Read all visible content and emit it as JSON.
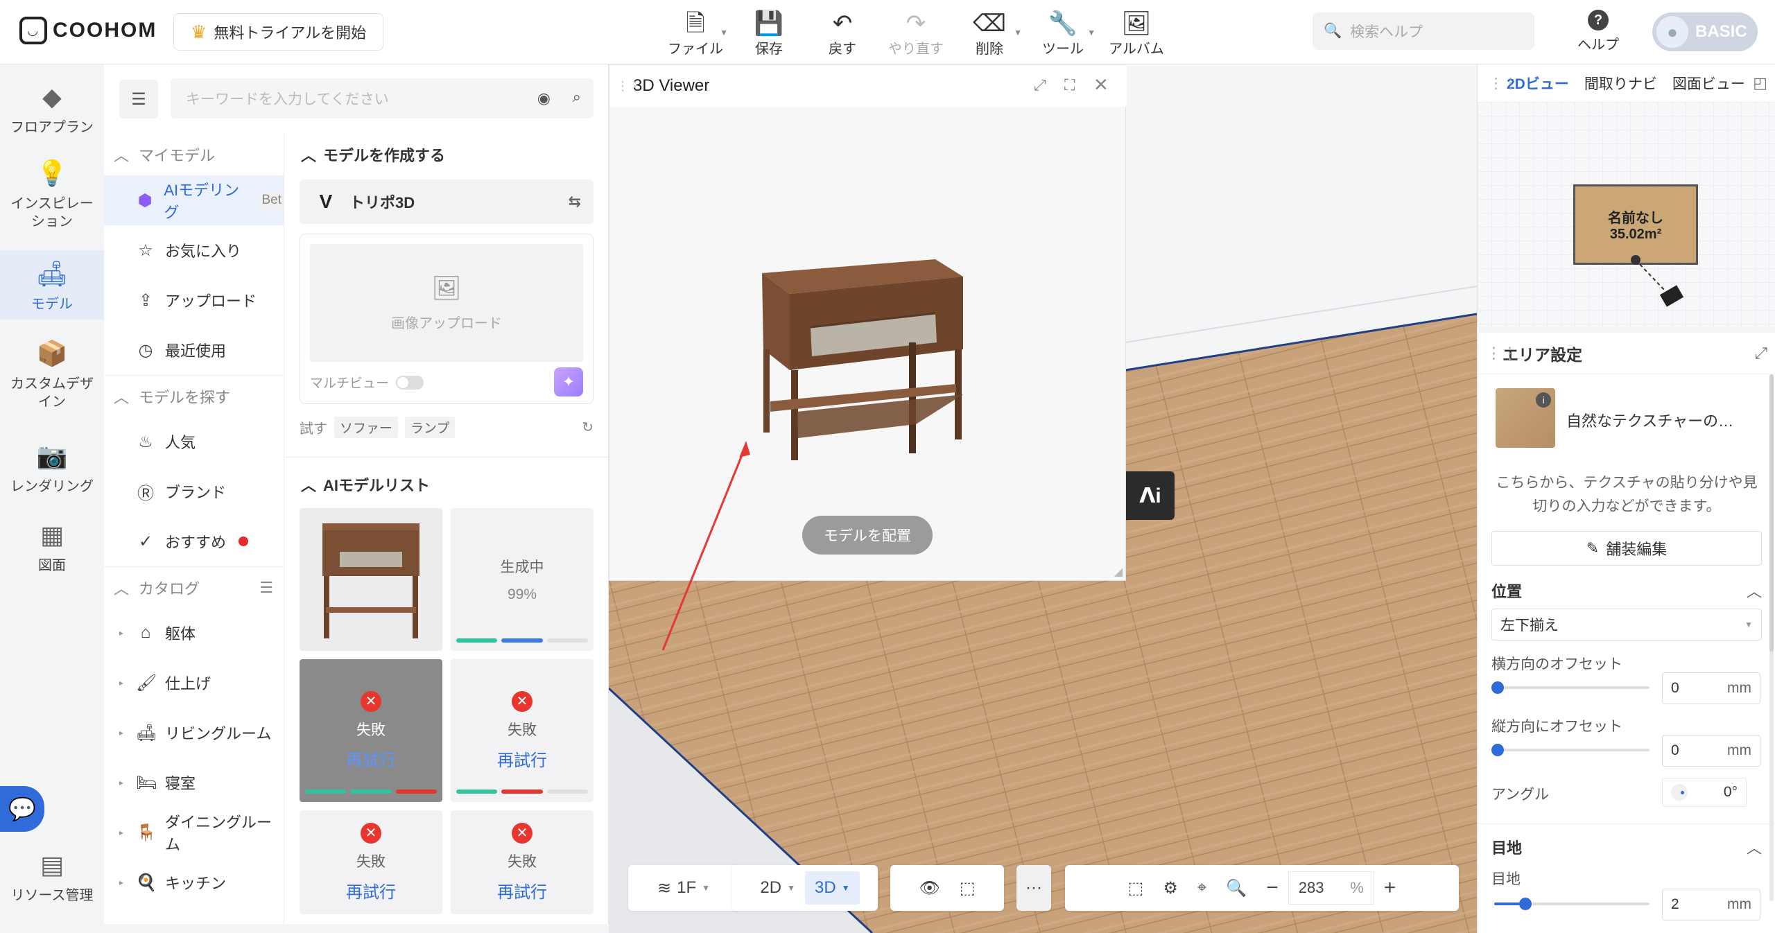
{
  "brand": {
    "name": "COOHOM"
  },
  "trial_button": "無料トライアルを開始",
  "toolbar": {
    "file": "ファイル",
    "save": "保存",
    "back": "戻す",
    "redo": "やり直す",
    "delete": "削除",
    "tools": "ツール",
    "album": "アルバム"
  },
  "help_search": {
    "placeholder": "検索ヘルプ"
  },
  "help": "ヘルプ",
  "user": {
    "plan": "BASIC"
  },
  "left_nav": {
    "floorplan": "フロアプラン",
    "inspiration": "インスピレーション",
    "model": "モデル",
    "custom_design": "カスタムデザイン",
    "rendering": "レンダリング",
    "drawing": "図面",
    "resources": "リソース管理"
  },
  "panel": {
    "search_placeholder": "キーワードを入力してください",
    "my_models": "マイモデル",
    "ai_modeling": "AIモデリング",
    "ai_modeling_tag": "Bet",
    "favorites": "お気に入り",
    "upload": "アップロード",
    "recent": "最近使用",
    "find_models": "モデルを探す",
    "popular": "人気",
    "brand": "ブランド",
    "recommended": "おすすめ",
    "catalog": "カタログ",
    "catalog_items": [
      "躯体",
      "仕上げ",
      "リビングルーム",
      "寝室",
      "ダイニングルーム",
      "キッチン"
    ]
  },
  "create": {
    "title": "モデルを作成する",
    "provider": "トリポ3D",
    "image_upload": "画像アップロード",
    "multiview": "マルチビュー",
    "try_label": "試す",
    "try_chips": [
      "ソファー",
      "ランプ"
    ]
  },
  "ai_list": {
    "title": "AIモデルリスト",
    "generating": "生成中",
    "progress": "99%",
    "failed": "失敗",
    "retry": "再試行"
  },
  "viewer": {
    "title": "3D Viewer",
    "place_button": "モデルを配置"
  },
  "bottom_bar": {
    "floor": "1F",
    "mode_2d": "2D",
    "mode_3d": "3D",
    "more": "···",
    "zoom": "283",
    "zoom_unit": "%"
  },
  "minimap": {
    "tabs": [
      "2Dビュー",
      "間取りナビ",
      "図面ビュー"
    ],
    "room_name": "名前なし",
    "room_area": "35.02m²"
  },
  "area_settings": {
    "title": "エリア設定",
    "texture_name": "自然なテクスチャーの…",
    "hint": "こちらから、テクスチャの貼り分けや見切りの入力などができます。",
    "edit_button": "舗装編集",
    "position_title": "位置",
    "position_value": "左下揃え",
    "h_offset_label": "横方向のオフセット",
    "h_offset": "0",
    "v_offset_label": "縦方向にオフセット",
    "v_offset": "0",
    "unit": "mm",
    "angle_label": "アングル",
    "angle": "0°",
    "joint_title": "目地",
    "joint_label": "目地",
    "joint_value": "2"
  },
  "colors": {
    "accent": "#2f6bd9",
    "error": "#e8362e"
  }
}
